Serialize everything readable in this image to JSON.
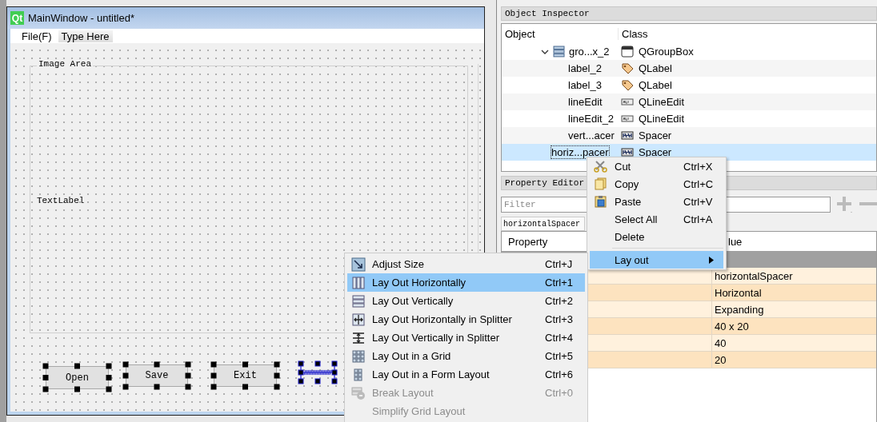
{
  "form_window": {
    "logo": "Qt",
    "title": "MainWindow - untitled*",
    "menus": [
      {
        "label": "File(F)",
        "kind": "menu"
      },
      {
        "label": "Type Here",
        "kind": "placeholder"
      }
    ],
    "group_box": {
      "title": "Image Area",
      "label": "TextLabel"
    },
    "buttons": [
      {
        "label": "Open",
        "selected": true
      },
      {
        "label": "Save",
        "selected": true
      },
      {
        "label": "Exit",
        "selected": true
      }
    ],
    "spacer": {
      "selected": true
    }
  },
  "object_inspector": {
    "title": "Object Inspector",
    "columns": [
      "Object",
      "Class"
    ],
    "rows": [
      {
        "name": "gro...x_2",
        "class": "QGroupBox",
        "kind": "groupbox",
        "expanded": true,
        "selected": false,
        "children": [
          {
            "name": "label_2",
            "class": "QLabel",
            "kind": "label",
            "selected": false
          },
          {
            "name": "label_3",
            "class": "QLabel",
            "kind": "label",
            "selected": false
          },
          {
            "name": "lineEdit",
            "class": "QLineEdit",
            "kind": "lineedit",
            "selected": false
          },
          {
            "name": "lineEdit_2",
            "class": "QLineEdit",
            "kind": "lineedit",
            "selected": false
          },
          {
            "name": "vert...acer",
            "class": "Spacer",
            "kind": "spacer",
            "selected": false
          }
        ]
      },
      {
        "name": "horiz...pacer",
        "class": "Spacer",
        "kind": "spacer",
        "selected": true
      }
    ]
  },
  "property_editor": {
    "title": "Property Editor",
    "filter": {
      "placeholder": "Filter"
    },
    "object_name": "horizontalSpacer",
    "columns": [
      "Property",
      "lue"
    ],
    "rows": [
      {
        "value": "horizontalSpacer"
      },
      {
        "value": "Horizontal"
      },
      {
        "value": "Expanding"
      },
      {
        "value": "40 x 20"
      },
      {
        "value": "40"
      },
      {
        "value": "20"
      }
    ]
  },
  "context_menu": {
    "items": [
      {
        "kind": "cut",
        "label": "Cut",
        "shortcut": "Ctrl+X",
        "selected": false
      },
      {
        "kind": "copy",
        "label": "Copy",
        "shortcut": "Ctrl+C",
        "selected": false
      },
      {
        "kind": "paste",
        "label": "Paste",
        "shortcut": "Ctrl+V",
        "selected": false
      },
      {
        "kind": "plain",
        "label": "Select All",
        "shortcut": "Ctrl+A",
        "selected": false
      },
      {
        "kind": "plain",
        "label": "Delete",
        "selected": false
      },
      {
        "kind": "separator"
      },
      {
        "kind": "submenu",
        "label": "Lay out",
        "selected": true
      }
    ]
  },
  "layout_submenu": {
    "items": [
      {
        "kind": "adjust",
        "label": "Adjust Size",
        "shortcut": "Ctrl+J",
        "selected": false,
        "disabled": false
      },
      {
        "kind": "hbox",
        "label": "Lay Out Horizontally",
        "shortcut": "Ctrl+1",
        "selected": true,
        "disabled": false
      },
      {
        "kind": "vbox",
        "label": "Lay Out Vertically",
        "shortcut": "Ctrl+2",
        "selected": false,
        "disabled": false
      },
      {
        "kind": "hsplit",
        "label": "Lay Out Horizontally in Splitter",
        "shortcut": "Ctrl+3",
        "selected": false,
        "disabled": false
      },
      {
        "kind": "vsplit",
        "label": "Lay Out Vertically in Splitter",
        "shortcut": "Ctrl+4",
        "selected": false,
        "disabled": false
      },
      {
        "kind": "grid",
        "label": "Lay Out in a Grid",
        "shortcut": "Ctrl+5",
        "selected": false,
        "disabled": false
      },
      {
        "kind": "form",
        "label": "Lay Out in a Form Layout",
        "shortcut": "Ctrl+6",
        "selected": false,
        "disabled": false
      },
      {
        "kind": "break",
        "label": "Break Layout",
        "shortcut": "Ctrl+0",
        "selected": false,
        "disabled": true
      },
      {
        "kind": "plain",
        "label": "Simplify Grid Layout",
        "selected": false,
        "disabled": true
      }
    ]
  }
}
